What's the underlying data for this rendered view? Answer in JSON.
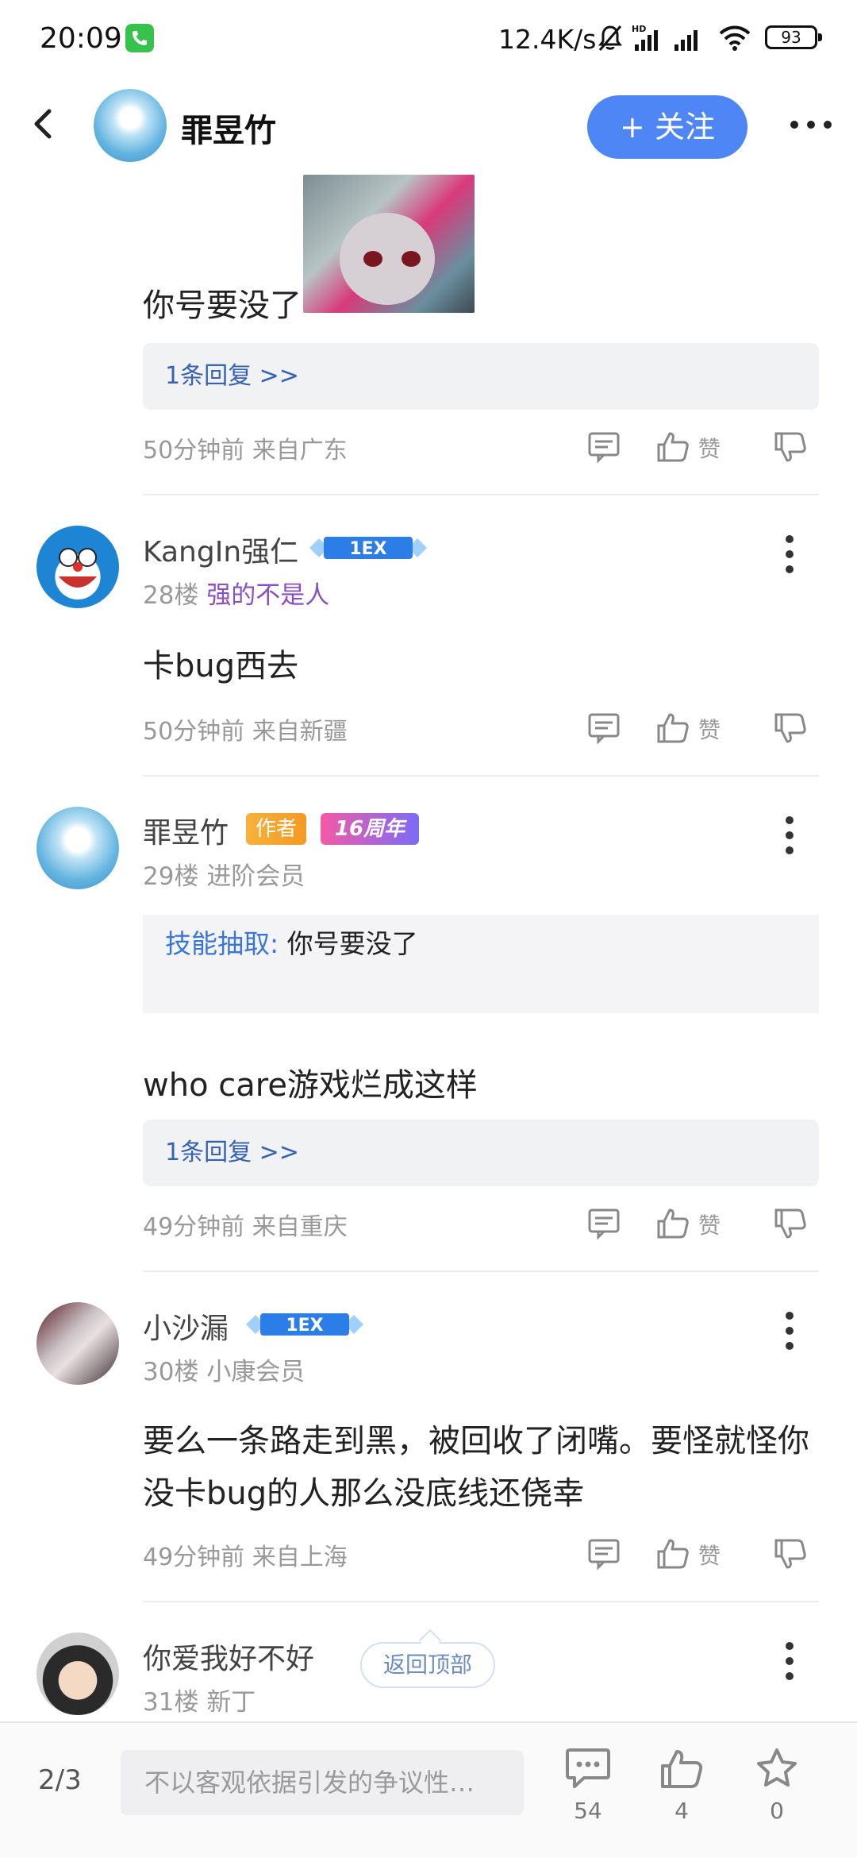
{
  "status_bar": {
    "time": "20:09",
    "net_speed": "12.4K/s",
    "battery": "93"
  },
  "header": {
    "user_name": "罪昱竹",
    "follow_label": "+ 关注"
  },
  "prev_post": {
    "text": "你号要没了",
    "reply_count_label": "1条回复 >>",
    "meta": "50分钟前 来自广东",
    "like_label": "赞"
  },
  "posts": [
    {
      "user_name": "KangIn强仁",
      "floor": "28楼",
      "title_tag": "强的不是人",
      "text": "卡bug西去",
      "meta": "50分钟前 来自新疆",
      "like_label": "赞"
    },
    {
      "user_name": "罪昱竹",
      "author_badge": "作者",
      "anniv_badge": "16周年",
      "floor": "29楼",
      "member_level": "进阶会员",
      "quote_key": "技能抽取:",
      "quote_value": "你号要没了",
      "text": "who care游戏烂成这样",
      "reply_count_label": "1条回复 >>",
      "meta": "49分钟前 来自重庆",
      "like_label": "赞"
    },
    {
      "user_name": "小沙漏",
      "floor": "30楼",
      "member_level": "小康会员",
      "text_line1": "要么一条路走到黑，被回收了闭嘴。要怪就怪你",
      "text_line2": "没卡bug的人那么没底线还侥幸",
      "meta": "49分钟前 来自上海",
      "like_label": "赞"
    },
    {
      "user_name": "你爱我好不好",
      "floor": "31楼",
      "member_level": "新丁"
    }
  ],
  "back_to_top": "返回顶部",
  "bottom_bar": {
    "page": "2/3",
    "input_placeholder": "不以客观依据引发的争议性…",
    "comment_count": "54",
    "like_count": "4",
    "star_count": "0"
  },
  "colors": {
    "accent": "#4e86f5",
    "link": "#3561b6",
    "meta": "#999999",
    "tag_purple": "#8a4fc4"
  }
}
